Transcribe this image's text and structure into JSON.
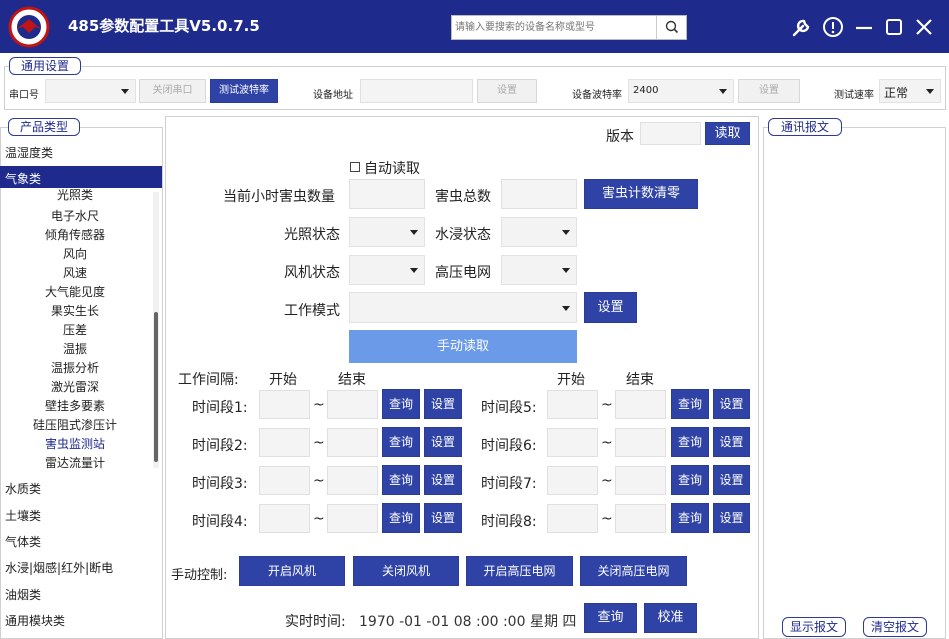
{
  "app": {
    "title": "485参数配置工具V5.0.7.5"
  },
  "search": {
    "placeholder": "请输入要搜索的设备名称或型号"
  },
  "general": {
    "legend": "通用设置",
    "port_label": "串口号",
    "close_port": "关闭串口",
    "test_baud": "测试波特率",
    "addr_label": "设备地址",
    "set1": "设置",
    "baud_label": "设备波特率",
    "baud_value": "2400",
    "set2": "设置",
    "speed_label": "测试速率",
    "speed_value": "正常"
  },
  "product": {
    "legend": "产品类型",
    "cats_top": [
      "温湿度类",
      "气象类"
    ],
    "subs": [
      "光照类",
      "电子水尺",
      "倾角传感器",
      "风向",
      "风速",
      "大气能见度",
      "果实生长",
      "压差",
      "温振",
      "温振分析",
      "激光雷深",
      "壁挂多要素",
      "硅压阻式渗压计",
      "害虫监测站",
      "雷达流量计"
    ],
    "cats_bottom": [
      "水质类",
      "土壤类",
      "气体类",
      "水浸|烟感|红外|断电",
      "油烟类",
      "通用模块类"
    ]
  },
  "main": {
    "version_label": "版本",
    "read": "读取",
    "auto_read": "自动读取",
    "hour_pest_label": "当前小时害虫数量",
    "total_pest_label": "害虫总数",
    "clear_btn": "害虫计数清零",
    "light_label": "光照状态",
    "water_label": "水浸状态",
    "fan_label": "风机状态",
    "hv_label": "高压电网",
    "mode_label": "工作模式",
    "mode_set": "设置",
    "manual_read": "手动读取",
    "interval_label": "工作间隔:",
    "start_label": "开始",
    "end_label": "结束",
    "tilde": "~",
    "query": "查询",
    "set": "设置",
    "periods": [
      "时间段1:",
      "时间段2:",
      "时间段3:",
      "时间段4:",
      "时间段5:",
      "时间段6:",
      "时间段7:",
      "时间段8:"
    ],
    "manual_ctrl": "手动控制:",
    "ctrl_btns": [
      "开启风机",
      "关闭风机",
      "开启高压电网",
      "关闭高压电网"
    ],
    "rt_label": "实时时间:",
    "rt_value": "1970 -01 -01  08 :00 :00  星期 四",
    "rt_query": "查询",
    "rt_calib": "校准"
  },
  "comm": {
    "legend": "通讯报文",
    "show": "显示报文",
    "clear": "清空报文"
  },
  "colors": {
    "accent": "#1e2a8c",
    "button": "#2f43a6",
    "manual_read": "#6a9ae8"
  }
}
